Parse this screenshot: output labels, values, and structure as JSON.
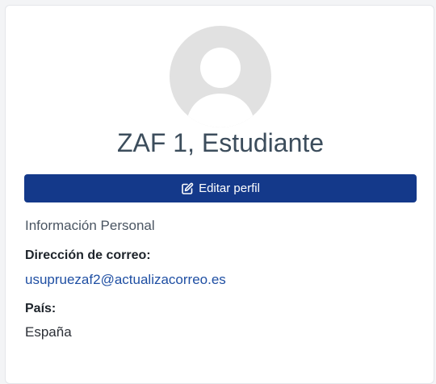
{
  "profile": {
    "name": "ZAF 1, Estudiante",
    "edit_button_label": "Editar perfil",
    "section_title": "Información Personal",
    "email_label": "Dirección de correo:",
    "email_value": "usupruezaf2@actualizacorreo.es",
    "country_label": "País:",
    "country_value": "España"
  },
  "icons": {
    "avatar": "user-avatar-placeholder",
    "edit": "edit-pencil-square-icon"
  },
  "colors": {
    "primary_button": "#14398a",
    "link": "#1f4fa3",
    "avatar_background": "#e1e1e1"
  }
}
